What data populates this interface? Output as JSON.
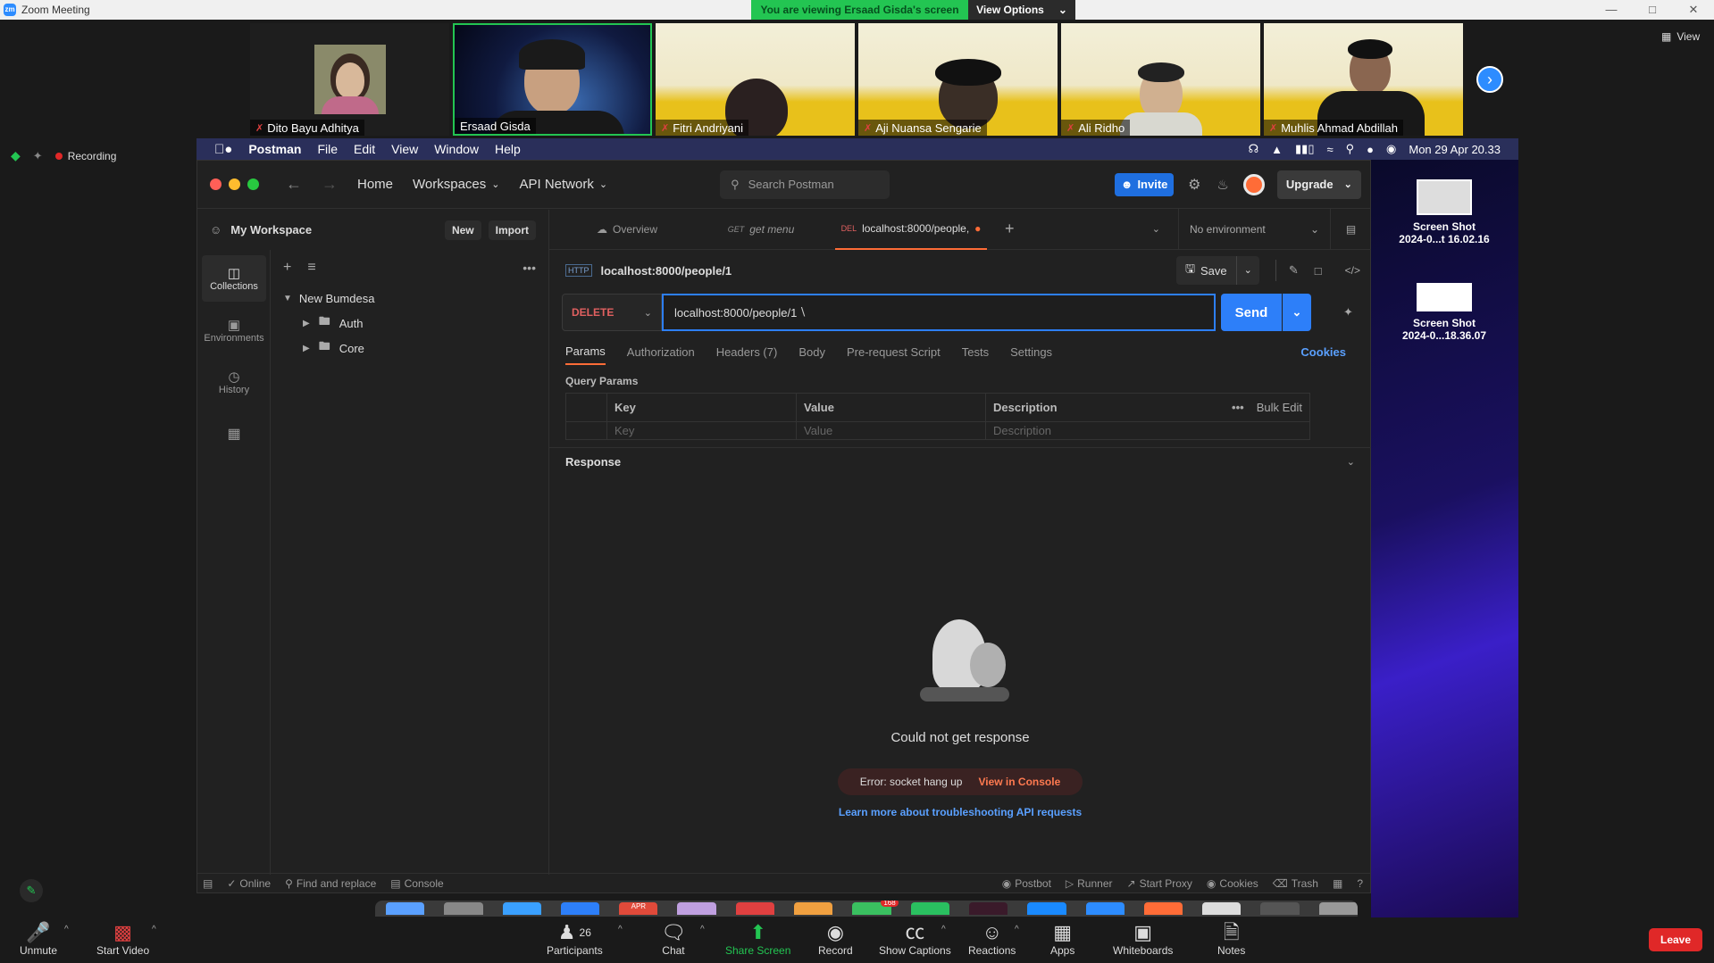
{
  "zoom": {
    "window_title": "Zoom Meeting",
    "viewing_banner": "You are viewing Ersaad Gisda's screen",
    "view_options": "View Options",
    "view_label": "View",
    "recording": "Recording",
    "participants": [
      {
        "name": "Dito Bayu Adhitya"
      },
      {
        "name": "Ersaad Gisda"
      },
      {
        "name": "Fitri Andriyani"
      },
      {
        "name": "Aji Nuansa Sengarie"
      },
      {
        "name": "Ali Ridho"
      },
      {
        "name": "Muhlis Ahmad Abdillah"
      }
    ],
    "controls": {
      "unmute": "Unmute",
      "start_video": "Start Video",
      "participants": "Participants",
      "participants_count": "26",
      "chat": "Chat",
      "share_screen": "Share Screen",
      "record": "Record",
      "show_captions": "Show Captions",
      "reactions": "Reactions",
      "apps": "Apps",
      "whiteboards": "Whiteboards",
      "notes": "Notes",
      "leave": "Leave"
    }
  },
  "mac_menu": {
    "app": "Postman",
    "items": [
      "File",
      "Edit",
      "View",
      "Window",
      "Help"
    ],
    "clock": "Mon 29 Apr  20.33"
  },
  "postman": {
    "nav": {
      "home": "Home",
      "workspaces": "Workspaces",
      "api_network": "API Network",
      "search_placeholder": "Search Postman",
      "invite": "Invite",
      "upgrade": "Upgrade"
    },
    "workspace": {
      "name": "My Workspace",
      "new": "New",
      "import": "Import"
    },
    "rail": {
      "collections": "Collections",
      "environments": "Environments",
      "history": "History"
    },
    "tree": {
      "collection": "New Bumdesa",
      "folders": [
        "Auth",
        "Core"
      ]
    },
    "tabs": {
      "overview": "Overview",
      "get_method": "GET",
      "get_name": "get menu",
      "del_method": "DEL",
      "del_name": "localhost:8000/people,",
      "environment": "No environment"
    },
    "request": {
      "title": "localhost:8000/people/1",
      "save": "Save",
      "method": "DELETE",
      "url": "localhost:8000/people/1",
      "send": "Send",
      "subtabs": [
        "Params",
        "Authorization",
        "Headers (7)",
        "Body",
        "Pre-request Script",
        "Tests",
        "Settings"
      ],
      "cookies": "Cookies",
      "query_params": "Query Params",
      "columns": {
        "key": "Key",
        "value": "Value",
        "description": "Description",
        "bulk_edit": "Bulk Edit"
      },
      "placeholders": {
        "key": "Key",
        "value": "Value",
        "description": "Description"
      }
    },
    "response": {
      "label": "Response",
      "empty_title": "Could not get response",
      "error": "Error: socket hang up",
      "view_console": "View in Console",
      "learn_more": "Learn more about troubleshooting API requests"
    },
    "statusbar": {
      "online": "Online",
      "find_replace": "Find and replace",
      "console": "Console",
      "postbot": "Postbot",
      "runner": "Runner",
      "start_proxy": "Start Proxy",
      "cookies": "Cookies",
      "trash": "Trash"
    }
  },
  "desktop": {
    "files": [
      {
        "name_line1": "Screen Shot",
        "name_line2": "2024-0...t 16.02.16"
      },
      {
        "name_line1": "Screen Shot",
        "name_line2": "2024-0...18.36.07"
      }
    ]
  },
  "dock": {
    "badge": "168",
    "calendar": "APR"
  }
}
